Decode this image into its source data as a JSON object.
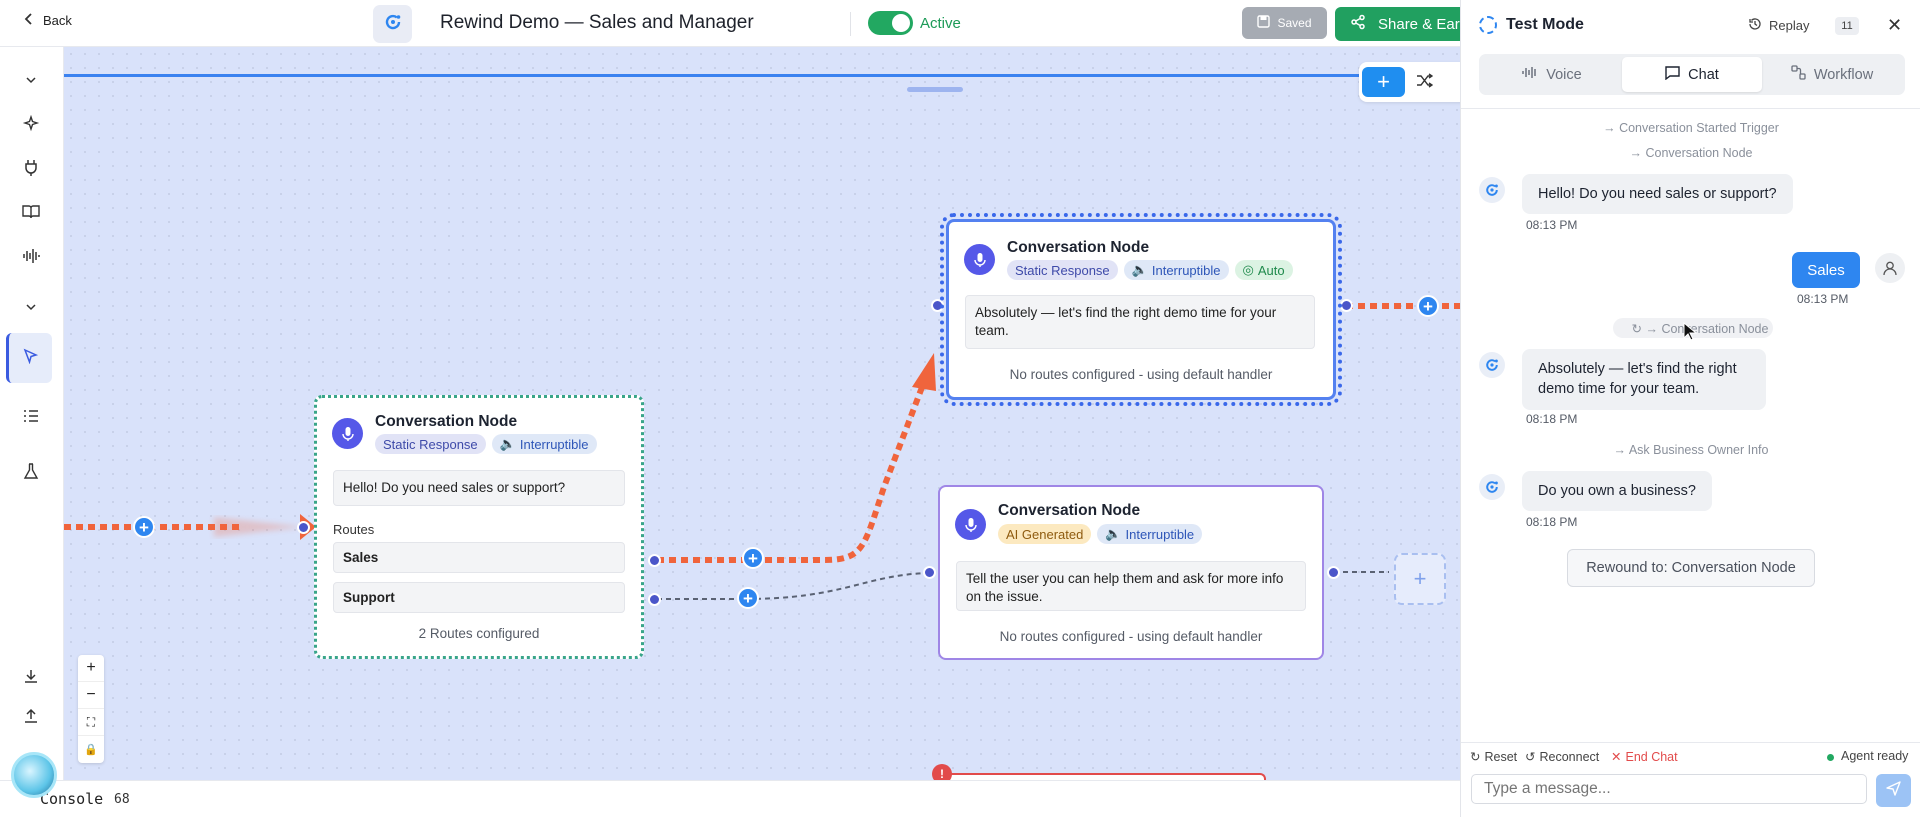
{
  "topbar": {
    "back_label": "Back",
    "project_title": "Rewind Demo — Sales and Manager",
    "status_label": "Active",
    "saved_label": "Saved",
    "share_label": "Share & Ear"
  },
  "canvas": {
    "nodes": [
      {
        "title": "Conversation Node",
        "tags": [
          "Static Response",
          "Interruptible"
        ],
        "message": "Hello! Do you need sales or support?",
        "routes_label": "Routes",
        "routes": [
          "Sales",
          "Support"
        ],
        "footer": "2 Routes configured"
      },
      {
        "title": "Conversation Node",
        "tags": [
          "Static Response",
          "Interruptible",
          "Auto"
        ],
        "message": "Absolutely — let's find the right demo time for your team.",
        "footer": "No routes configured - using default handler"
      },
      {
        "title": "Conversation Node",
        "tags": [
          "AI Generated",
          "Interruptible"
        ],
        "message": "Tell the user you can help them and ask for more info on the issue.",
        "footer": "No routes configured - using default handler"
      }
    ],
    "zoom_controls": [
      "+",
      "−",
      "⛶",
      "🔒"
    ]
  },
  "console": {
    "label": "Console",
    "count": "68"
  },
  "panel": {
    "title": "Test Mode",
    "replay_label": "Replay",
    "replay_count": "11",
    "tabs": [
      "Voice",
      "Chat",
      "Workflow"
    ],
    "active_tab": "Chat",
    "trace": [
      "→ Conversation Started Trigger",
      "→ Conversation Node",
      "→ Conversation Node",
      "→ Ask Business Owner Info"
    ],
    "messages": [
      {
        "role": "bot",
        "text": "Hello! Do you need sales or support?",
        "time": "08:13 PM"
      },
      {
        "role": "user",
        "text": "Sales",
        "time": "08:13 PM"
      },
      {
        "role": "bot",
        "text": "Absolutely — let's find the right demo time for your team.",
        "time": "08:18 PM"
      },
      {
        "role": "bot",
        "text": "Do you own a business?",
        "time": "08:18 PM"
      }
    ],
    "rewound_label": "Rewound to: Conversation Node",
    "footer": {
      "reset": "Reset",
      "reconnect": "Reconnect",
      "end_chat": "End Chat",
      "status": "Agent ready"
    },
    "input_placeholder": "Type a message..."
  },
  "colors": {
    "accent": "#2e86f0",
    "active_green": "#22a861",
    "edge_active": "#f0643c",
    "danger": "#e24b4b"
  }
}
